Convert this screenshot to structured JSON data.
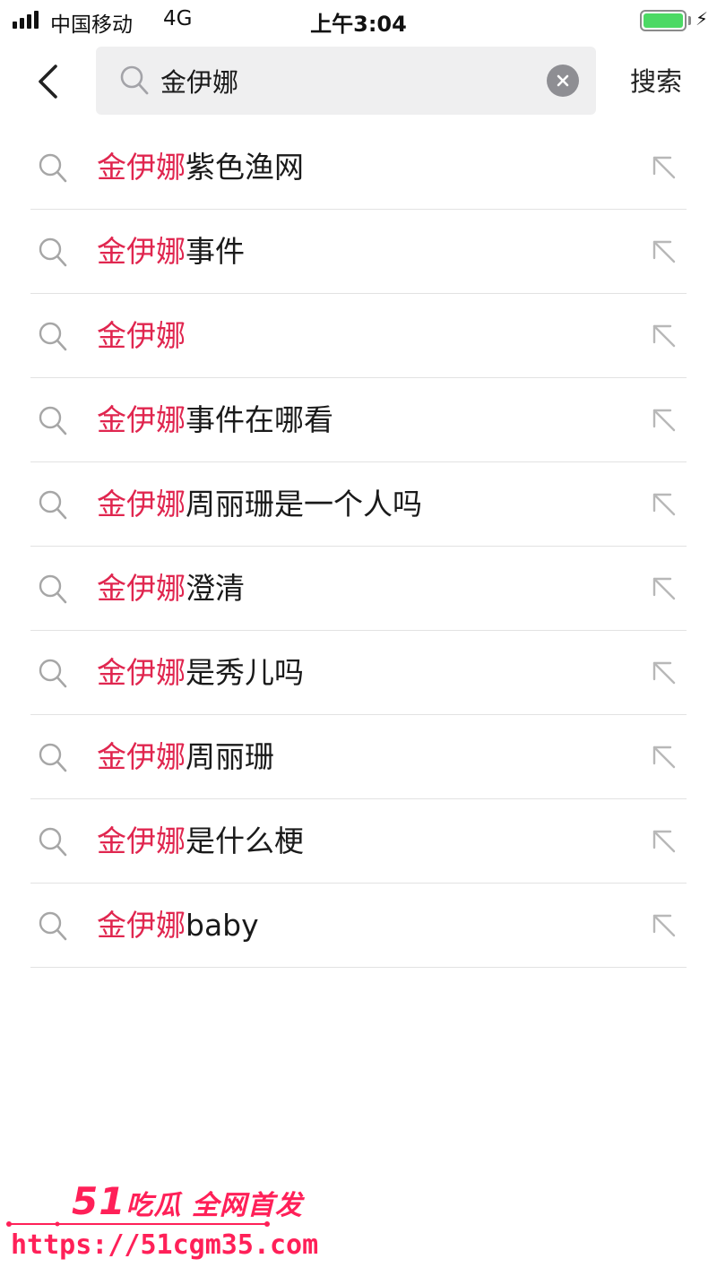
{
  "status_bar": {
    "carrier": "中国移动",
    "network": "4G",
    "time": "上午3:04",
    "battery_level": 1.0
  },
  "search": {
    "query": "金伊娜",
    "search_label": "搜索",
    "icons": [
      "back-icon",
      "search-icon",
      "clear-icon"
    ]
  },
  "suggestions": [
    {
      "highlight": "金伊娜",
      "rest": "紫色渔网"
    },
    {
      "highlight": "金伊娜",
      "rest": "事件"
    },
    {
      "highlight": "金伊娜",
      "rest": ""
    },
    {
      "highlight": "金伊娜",
      "rest": "事件在哪看"
    },
    {
      "highlight": "金伊娜",
      "rest": "周丽珊是一个人吗"
    },
    {
      "highlight": "金伊娜",
      "rest": "澄清"
    },
    {
      "highlight": "金伊娜",
      "rest": "是秀儿吗"
    },
    {
      "highlight": "金伊娜",
      "rest": "周丽珊"
    },
    {
      "highlight": "金伊娜",
      "rest": "是什么梗"
    },
    {
      "highlight": "金伊娜",
      "rest": "baby"
    }
  ],
  "watermark": {
    "brand_number": "51",
    "brand_text": "吃瓜 全网首发",
    "url": "https://51cgm35.com"
  },
  "colors": {
    "highlight": "#e0264f",
    "watermark": "#ff2058",
    "search_box_bg": "#efeff0",
    "battery": "#4cd964"
  }
}
